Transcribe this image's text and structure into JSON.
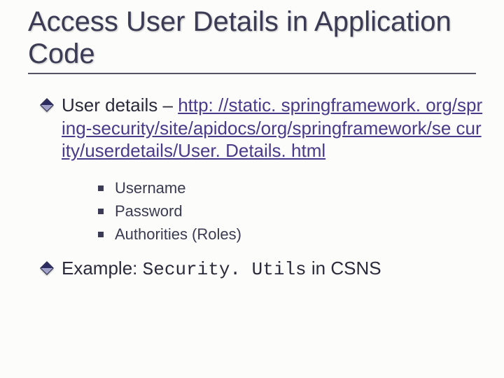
{
  "title": "Access User Details in Application Code",
  "bullets": {
    "b1_prefix": "User details – ",
    "b1_link": "http: //static. springframework. org/spring-security/site/apidocs/org/springframework/se curity/userdetails/User. Details. html",
    "sub": {
      "s1": "Username",
      "s2": "Password",
      "s3": "Authorities (Roles)"
    },
    "b2_prefix": "Example: ",
    "b2_code": "Security. Utils",
    "b2_suffix": " in CSNS"
  }
}
